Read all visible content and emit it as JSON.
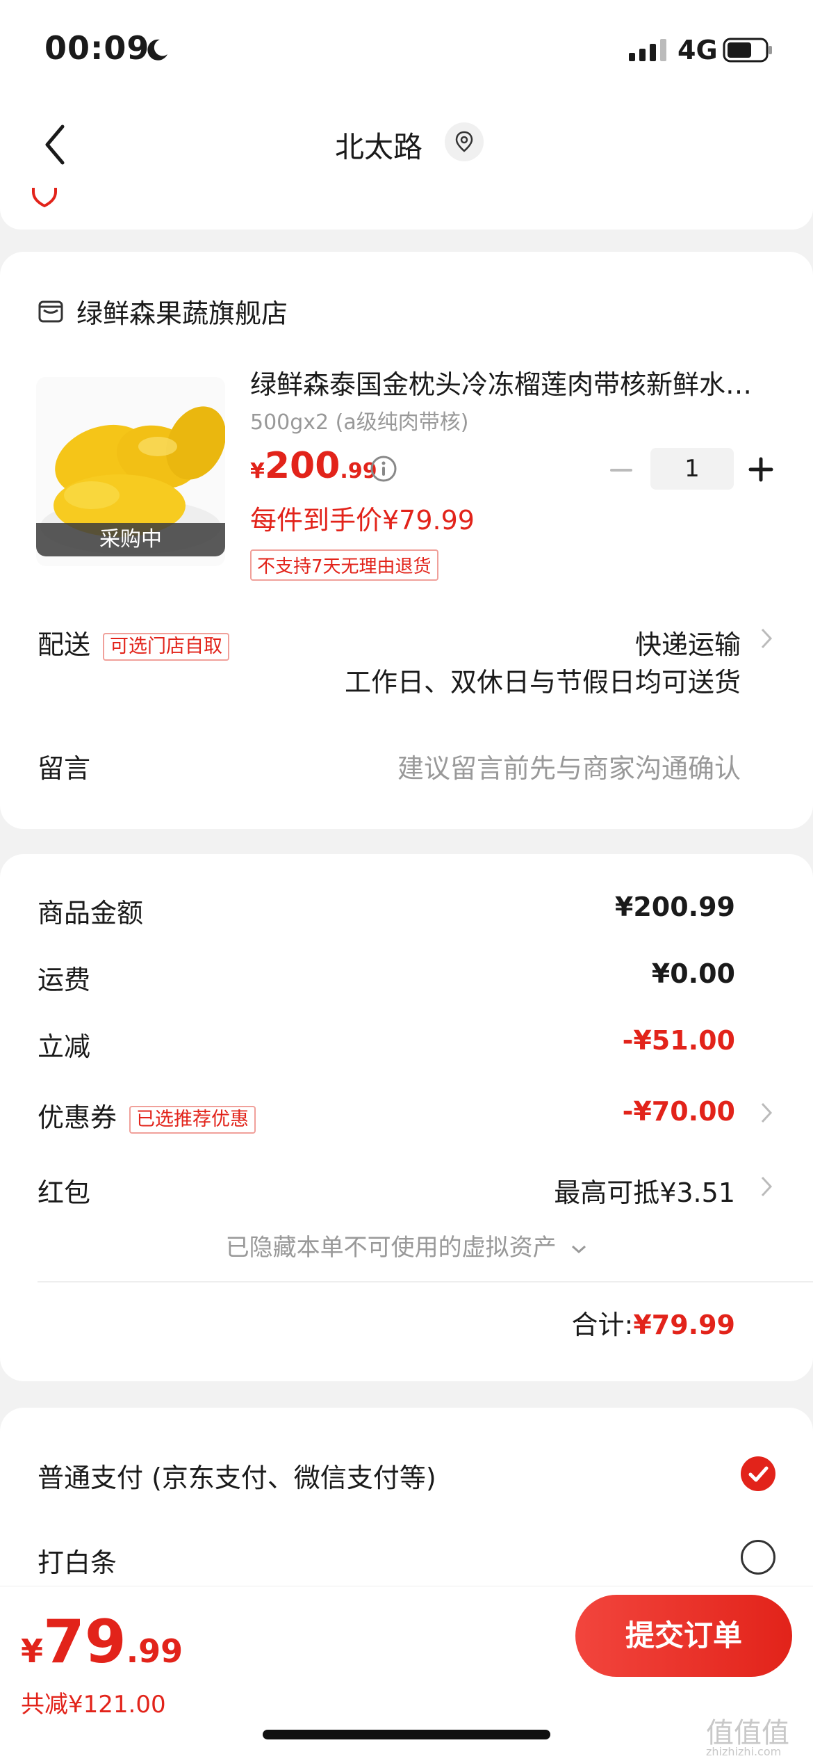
{
  "status_bar": {
    "time": "00:09",
    "network": "4G"
  },
  "nav": {
    "title": "北太路"
  },
  "shop": {
    "name": "绿鲜森果蔬旗舰店"
  },
  "product": {
    "title": "绿鲜森泰国金枕头冷冻榴莲肉带核新鲜水…",
    "spec": "500gx2 (a级纯肉带核)",
    "price_symbol": "¥",
    "price_integer": "200",
    "price_decimal": ".99",
    "unit_price": "每件到手价¥79.99",
    "return_policy": "不支持7天无理由退货",
    "image_badge": "采购中",
    "quantity": "1"
  },
  "delivery": {
    "label": "配送",
    "tag": "可选门店自取",
    "method": "快递运输",
    "schedule": "工作日、双休日与节假日均可送货"
  },
  "message": {
    "label": "留言",
    "placeholder": "建议留言前先与商家沟通确认"
  },
  "summary": {
    "goods_label": "商品金额",
    "goods_value": "¥200.99",
    "shipping_label": "运费",
    "shipping_value": "¥0.00",
    "discount_label": "立减",
    "discount_value": "-¥51.00",
    "coupon_label": "优惠券",
    "coupon_tag": "已选推荐优惠",
    "coupon_value": "-¥70.00",
    "redpacket_label": "红包",
    "redpacket_value": "最高可抵¥3.51",
    "hidden_assets": "已隐藏本单不可使用的虚拟资产",
    "total_label": "合计:",
    "total_value": "¥79.99"
  },
  "payment": {
    "option_normal": "普通支付 (京东支付、微信支付等)",
    "option_baitiao": "打白条",
    "selected": "普通支付"
  },
  "bottom": {
    "total_symbol": "¥",
    "total_integer": "79",
    "total_decimal": ".99",
    "saved": "共减¥121.00",
    "submit": "提交订单",
    "watermark": "值值值",
    "watermark_sub": "zhizhizhi.com"
  },
  "colors": {
    "accent": "#e2231a",
    "background": "#f2f2f2"
  }
}
